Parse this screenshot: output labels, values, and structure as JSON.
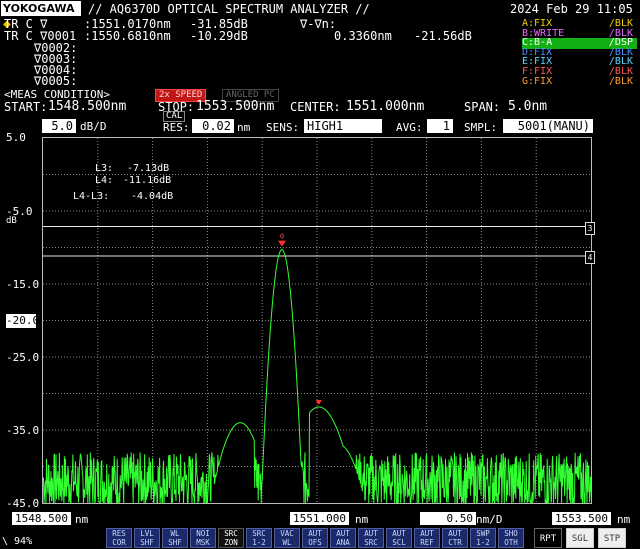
{
  "header": {
    "logo": "YOKOGAWA",
    "title": "// AQ6370D OPTICAL SPECTRUM ANALYZER //",
    "datetime": "2024 Feb 29 11:05"
  },
  "markers": {
    "row1": {
      "label": "TR C ∇",
      "wl": ":1551.0170nm",
      "pow": "-31.85dB",
      "dtitle": "∇-∇n:"
    },
    "row2": {
      "label": "TR C ∇0001",
      "wl": ":1550.6810nm",
      "pow": "-10.29dB",
      "dwl": "0.3360nm",
      "dpow": "-21.56dB"
    },
    "row3": "∇0002:",
    "row4": "∇0003:",
    "row5": "∇0004:",
    "row6": "∇0005:"
  },
  "traces": [
    {
      "name": "A:FIX",
      "mode": "/BLK",
      "color": "#f2d000"
    },
    {
      "name": "B:WRITE",
      "mode": "/BLK",
      "color": "#e36bff"
    },
    {
      "name": "C:B-A",
      "mode": "/DSP",
      "color": "#ffffff",
      "active": true
    },
    {
      "name": "D:FIX",
      "mode": "/BLK",
      "color": "#4c8dff"
    },
    {
      "name": "E:FIX",
      "mode": "/BLK",
      "color": "#5ad2ff"
    },
    {
      "name": "F:FIX",
      "mode": "/BLK",
      "color": "#ff5656"
    },
    {
      "name": "G:FIX",
      "mode": "/BLK",
      "color": "#ffa030"
    }
  ],
  "meas": {
    "heading": "<MEAS CONDITION>",
    "badge_speed": "2x SPEED",
    "badge_angled": "ANGLED PC",
    "start_label": "START:",
    "start_value": "1548.500nm",
    "stop_label": "STOP:",
    "stop_value": "1553.500nm",
    "center_label": "CENTER:",
    "center_value": "1551.000nm",
    "span_label": "SPAN:",
    "span_value": "5.0nm"
  },
  "settings": {
    "scale_value": "5.0",
    "scale_unit": "dB/D",
    "cal": "CAL",
    "res_label": "RES:",
    "res_value": "0.02",
    "res_unit": "nm",
    "sens_label": "SENS:",
    "sens_value": "HIGH1",
    "avg_label": "AVG:",
    "avg_value": "1",
    "smpl_label": "SMPL:",
    "smpl_value": "5001(MANU)"
  },
  "plot": {
    "y_ticks": [
      "5.0",
      "-5.0",
      "-15.0",
      "-25.0",
      "-35.0",
      "-45.0"
    ],
    "ref_level": "-20.0",
    "db_unit": "dB",
    "line_markers": [
      {
        "label": "L3:",
        "value": "-7.13dB"
      },
      {
        "label": "L4:",
        "value": "-11.16dB"
      },
      {
        "label": "L4-L3:",
        "value": "-4.04dB"
      }
    ],
    "line3_tag": "3",
    "line4_tag": "4",
    "trace_color": "#32ff32",
    "peak_marker_label": "0"
  },
  "chart_data": {
    "type": "line",
    "xlabel": "",
    "ylabel": "",
    "xlim": [
      1548.5,
      1553.5
    ],
    "ylim": [
      -45.0,
      5.0
    ],
    "reference_lines_dB": {
      "L3": -7.13,
      "L4": -11.16
    },
    "series": [
      {
        "values_description": "single green trace",
        "x": [
          1548.5,
          1549.0,
          1549.5,
          1550.0,
          1550.2,
          1550.35,
          1550.5,
          1550.6,
          1550.68,
          1550.8,
          1550.9,
          1551.0,
          1551.017,
          1551.1,
          1551.3,
          1551.5,
          1552.0,
          1552.5,
          1553.0,
          1553.5
        ],
        "y": [
          -41,
          -41,
          -40,
          -38,
          -34,
          -26,
          -15,
          -11,
          -10.29,
          -13,
          -24,
          -32,
          -31.85,
          -34,
          -40,
          -40,
          -41,
          -40,
          -41,
          -41
        ]
      }
    ]
  },
  "bottom": {
    "x_start": "1548.500",
    "x_start_unit": "nm",
    "x_center": "1551.000",
    "x_center_unit": "nm",
    "x_div": "0.50",
    "x_div_unit": "nm/D",
    "x_stop": "1553.500",
    "x_stop_unit": "nm",
    "progress": "\\ 94%",
    "buttons": [
      [
        "RES",
        "COR"
      ],
      [
        "LVL",
        "SHF"
      ],
      [
        "WL",
        "SHF"
      ],
      [
        "NOI",
        "MSK"
      ],
      [
        "SRC",
        "ZON"
      ],
      [
        "SRC",
        "1-2"
      ],
      [
        "VAC",
        "WL"
      ],
      [
        "AUT",
        "OFS"
      ],
      [
        "AUT",
        "ANA"
      ],
      [
        "AUT",
        "SRC"
      ],
      [
        "AUT",
        "SCL"
      ],
      [
        "AUT",
        "REF"
      ],
      [
        "AUT",
        "CTR"
      ],
      [
        "SWP",
        "1-2"
      ],
      [
        "SHO",
        "OTH"
      ]
    ],
    "rpt": "RPT",
    "sgl": "SGL",
    "stp": "STP"
  }
}
